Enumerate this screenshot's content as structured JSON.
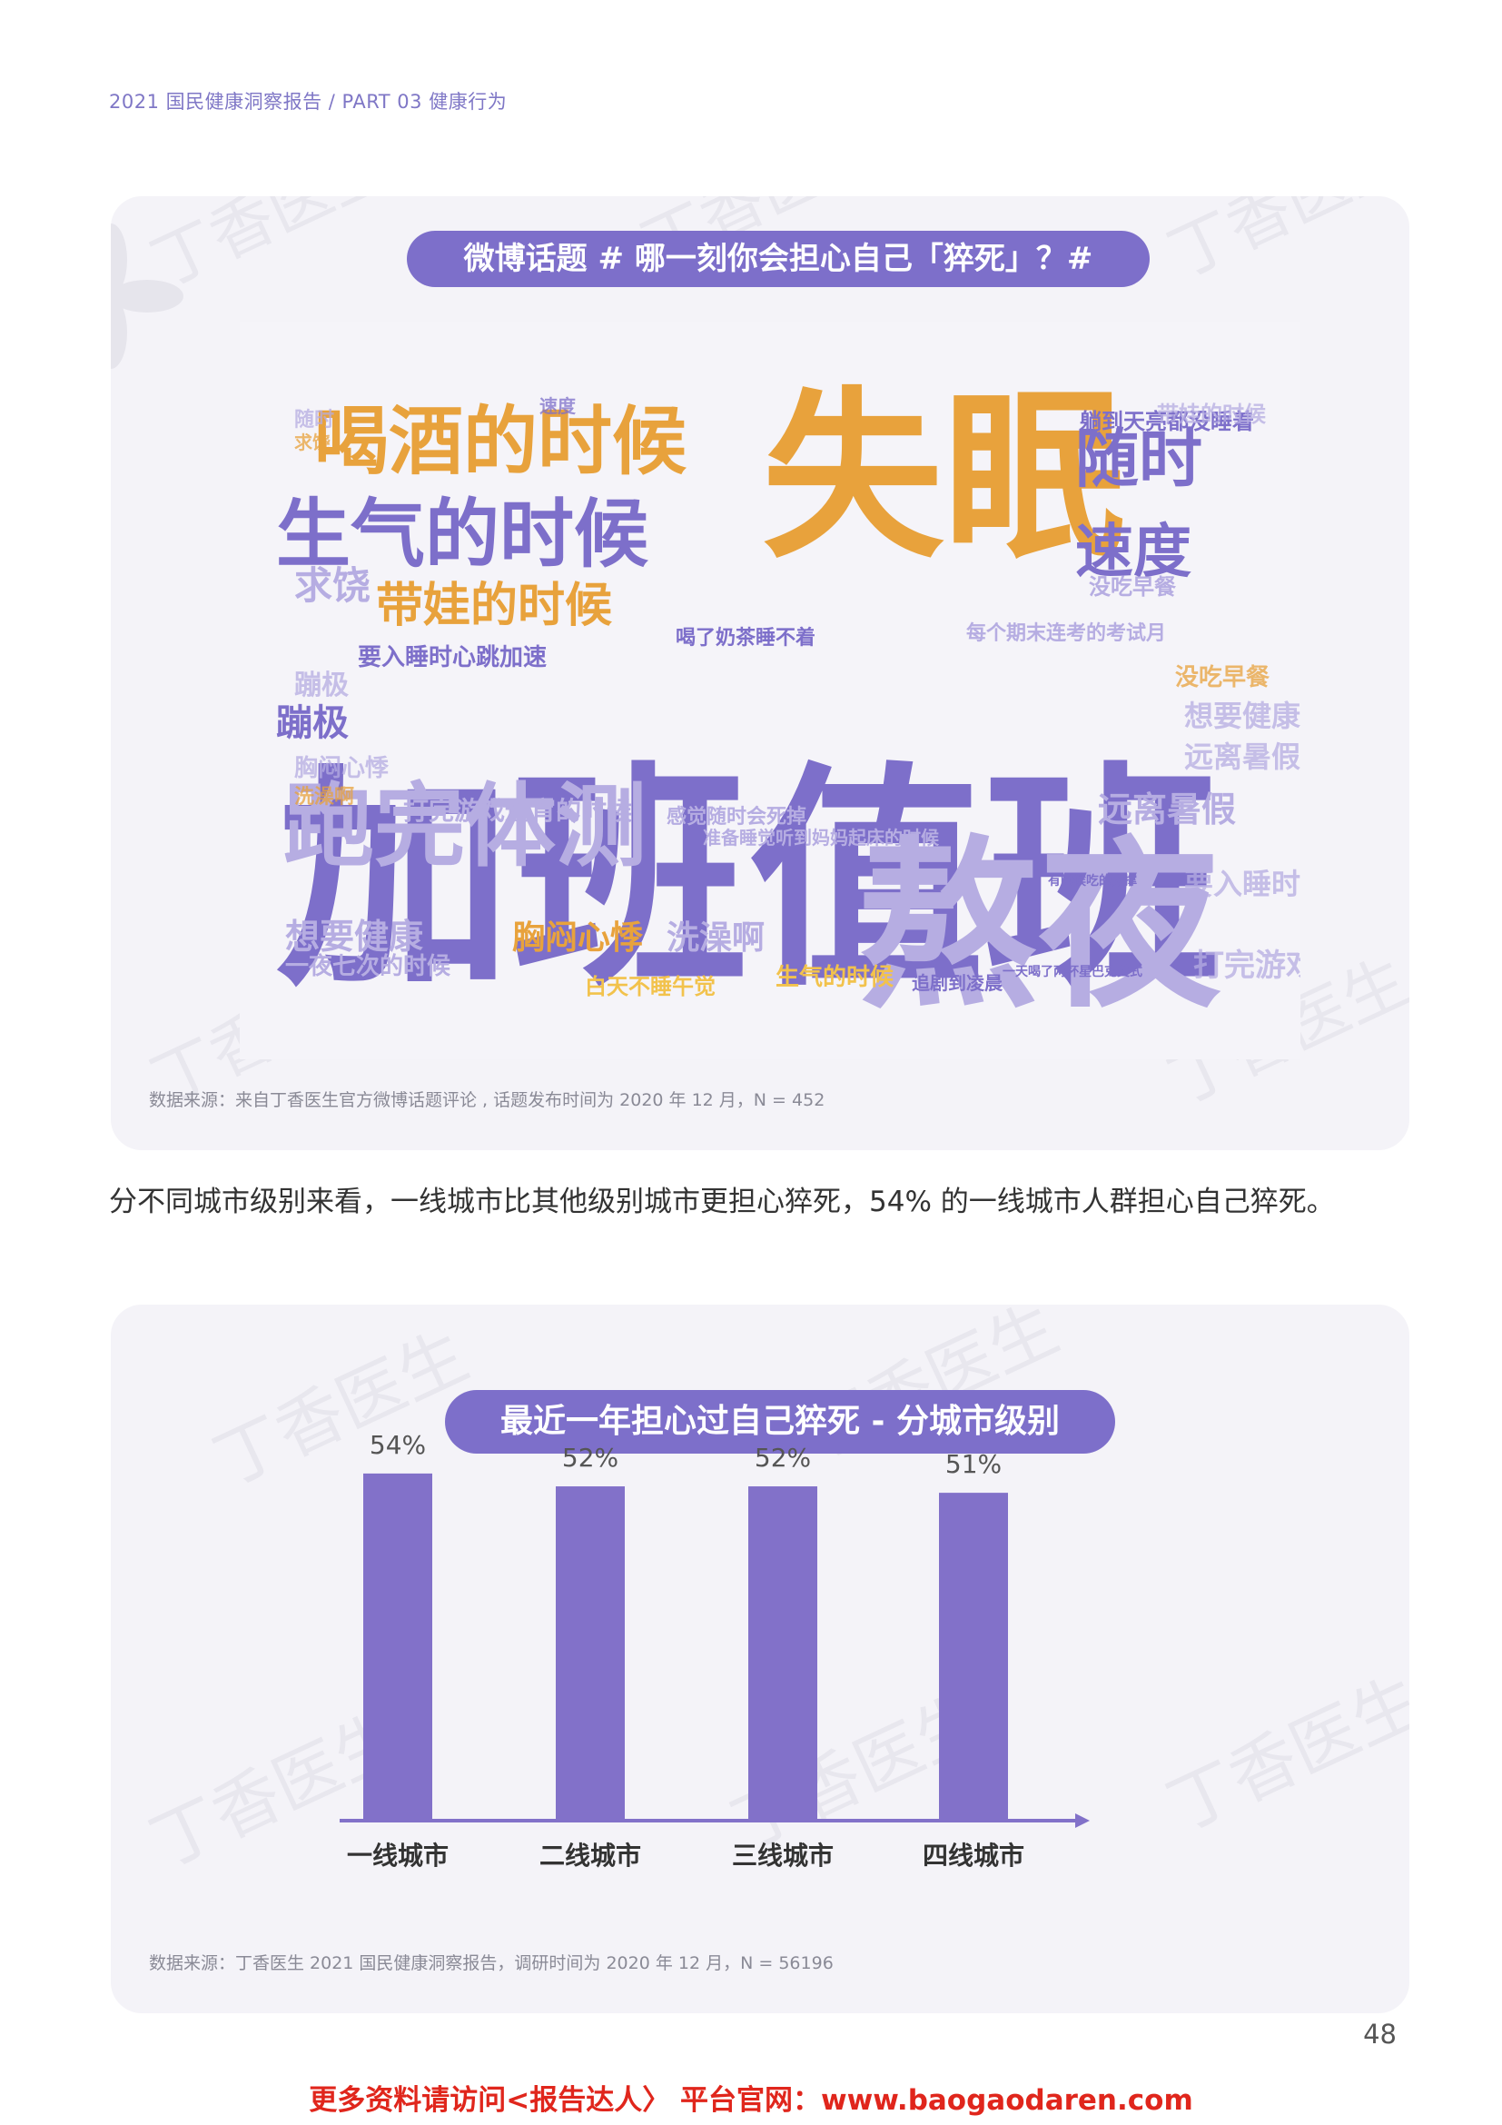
{
  "header": {
    "text": "2021 国民健康洞察报告 / PART 03 健康行为"
  },
  "watermark": {
    "text": "丁香医生"
  },
  "wordcloud": {
    "title": "微博话题 # 哪一刻你会担心自己「猝死」？#",
    "source": "数据来源：来自丁香医生官方微博话题评论 , 话题发布时间为 2020 年 12 月，N = 452",
    "words": [
      {
        "text": "加班值班",
        "tier": 1
      },
      {
        "text": "失眠",
        "tier": 1
      },
      {
        "text": "熬夜",
        "tier": 1
      },
      {
        "text": "跑完体测",
        "tier": 2
      },
      {
        "text": "喝酒的时候",
        "tier": 2
      },
      {
        "text": "生气的时候",
        "tier": 2
      },
      {
        "text": "随时",
        "tier": 3
      },
      {
        "text": "速度",
        "tier": 3
      },
      {
        "text": "带娃的时候",
        "tier": 3
      },
      {
        "text": "求饶",
        "tier": 3
      },
      {
        "text": "蹦极",
        "tier": 3
      },
      {
        "text": "胸闷心悸",
        "tier": 3
      },
      {
        "text": "洗澡啊",
        "tier": 3
      },
      {
        "text": "想要健康",
        "tier": 3
      },
      {
        "text": "远离暑假",
        "tier": 3
      },
      {
        "text": "没吃早餐",
        "tier": 4
      },
      {
        "text": "要入睡时心跳加速",
        "tier": 4
      },
      {
        "text": "打完游戏通宵的时候",
        "tier": 4
      },
      {
        "text": "白天不睡午觉",
        "tier": 4
      },
      {
        "text": "一夜七次的时候",
        "tier": 4
      },
      {
        "text": "生气的时候",
        "tier": 4
      },
      {
        "text": "追剧到凌晨",
        "tier": 4
      },
      {
        "text": "躺到天亮都没睡着",
        "tier": 4
      },
      {
        "text": "感觉随时会死掉",
        "tier": 4
      },
      {
        "text": "喝了奶茶睡不着",
        "tier": 4
      },
      {
        "text": "每个期末连考的考试月",
        "tier": 4
      },
      {
        "text": "有时候吃的太撑",
        "tier": 4
      },
      {
        "text": "一天喝了两杯星巴克美式",
        "tier": 4
      },
      {
        "text": "准备睡觉听到妈妈起床的时候",
        "tier": 4
      }
    ]
  },
  "intro_text": "分不同城市级别来看，一线城市比其他级别城市更担心猝死，54% 的一线城市人群担心自己猝死。",
  "chart": {
    "title": "最近一年担心过自己猝死 - 分城市级别",
    "source": "数据来源：丁香医生 2021 国民健康洞察报告，调研时间为 2020 年 12 月，N = 56196"
  },
  "chart_data": {
    "type": "bar",
    "categories": [
      "一线城市",
      "二线城市",
      "三线城市",
      "四线城市"
    ],
    "values": [
      54,
      52,
      52,
      51
    ],
    "value_labels": [
      "54%",
      "52%",
      "52%",
      "51%"
    ],
    "title": "最近一年担心过自己猝死 - 分城市级别",
    "xlabel": "",
    "ylabel": "",
    "ylim": [
      0,
      60
    ],
    "grid": false,
    "bar_color": "#8271c9",
    "axis_color": "#8271c9"
  },
  "page_number": "48",
  "footer": {
    "text": "更多资料请访问<报告达人〉 平台官网：www.baogaodaren.com"
  },
  "colors": {
    "purple": "#7d6fca",
    "orange": "#e8a23c",
    "lightpurple": "#b6ade2",
    "gold": "#f2c24c"
  }
}
